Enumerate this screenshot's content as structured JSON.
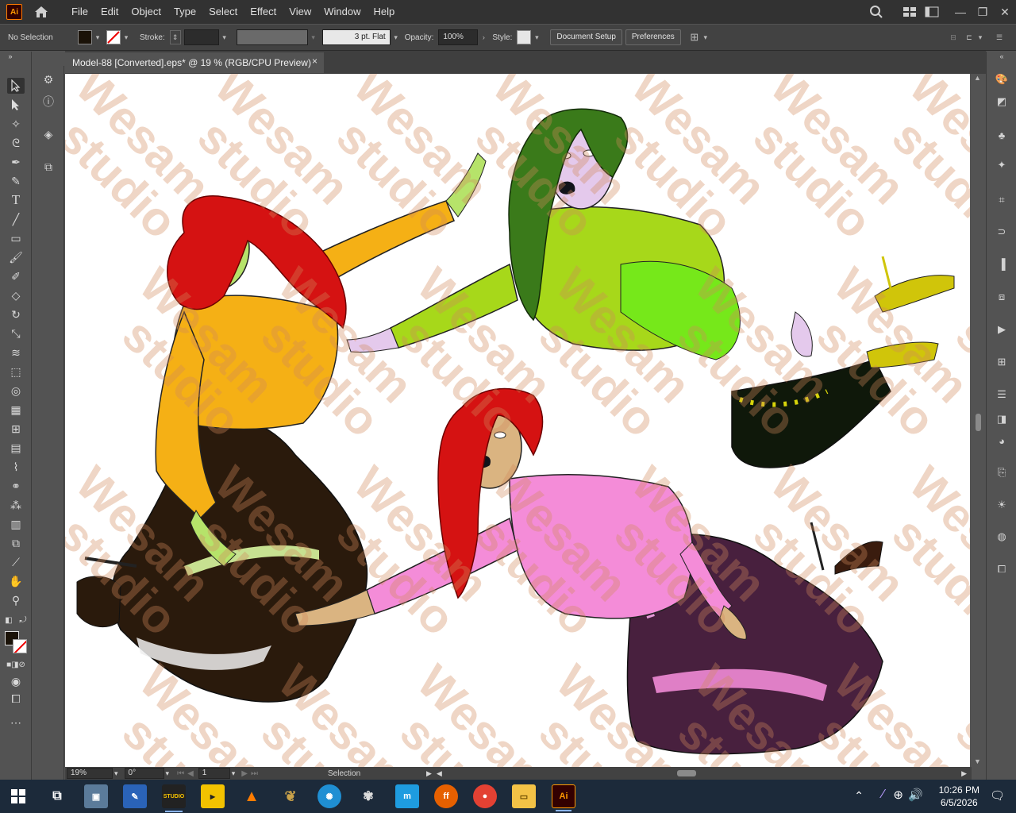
{
  "app": {
    "logo": "Ai"
  },
  "menu": [
    "File",
    "Edit",
    "Object",
    "Type",
    "Select",
    "Effect",
    "View",
    "Window",
    "Help"
  ],
  "control": {
    "selection": "No Selection",
    "stroke_label": "Stroke:",
    "brush": "3 pt. Flat",
    "opacity_label": "Opacity:",
    "opacity": "100%",
    "style_label": "Style:",
    "document_setup": "Document Setup",
    "preferences": "Preferences"
  },
  "document": {
    "tab_title": "Model-88 [Converted].eps* @ 19 % (RGB/CPU Preview)",
    "close": "×"
  },
  "artwork": {
    "watermark": "Wesam studio"
  },
  "status": {
    "zoom": "19%",
    "rotation": "0°",
    "artboard": "1",
    "tool": "Selection"
  },
  "taskbar": {
    "time": "10:26 PM",
    "date": "6/5/2026",
    "apps": [
      "file-explorer",
      "paint",
      "studio",
      "player",
      "vlc",
      "gimp",
      "krita",
      "inkscape",
      "mi",
      "firefox",
      "chrome",
      "folder",
      "illustrator"
    ]
  },
  "colors": {
    "accent": "#ff9a00",
    "ui_dark": "#323232",
    "ui_mid": "#535353",
    "taskbar": "#1c2a3a"
  }
}
